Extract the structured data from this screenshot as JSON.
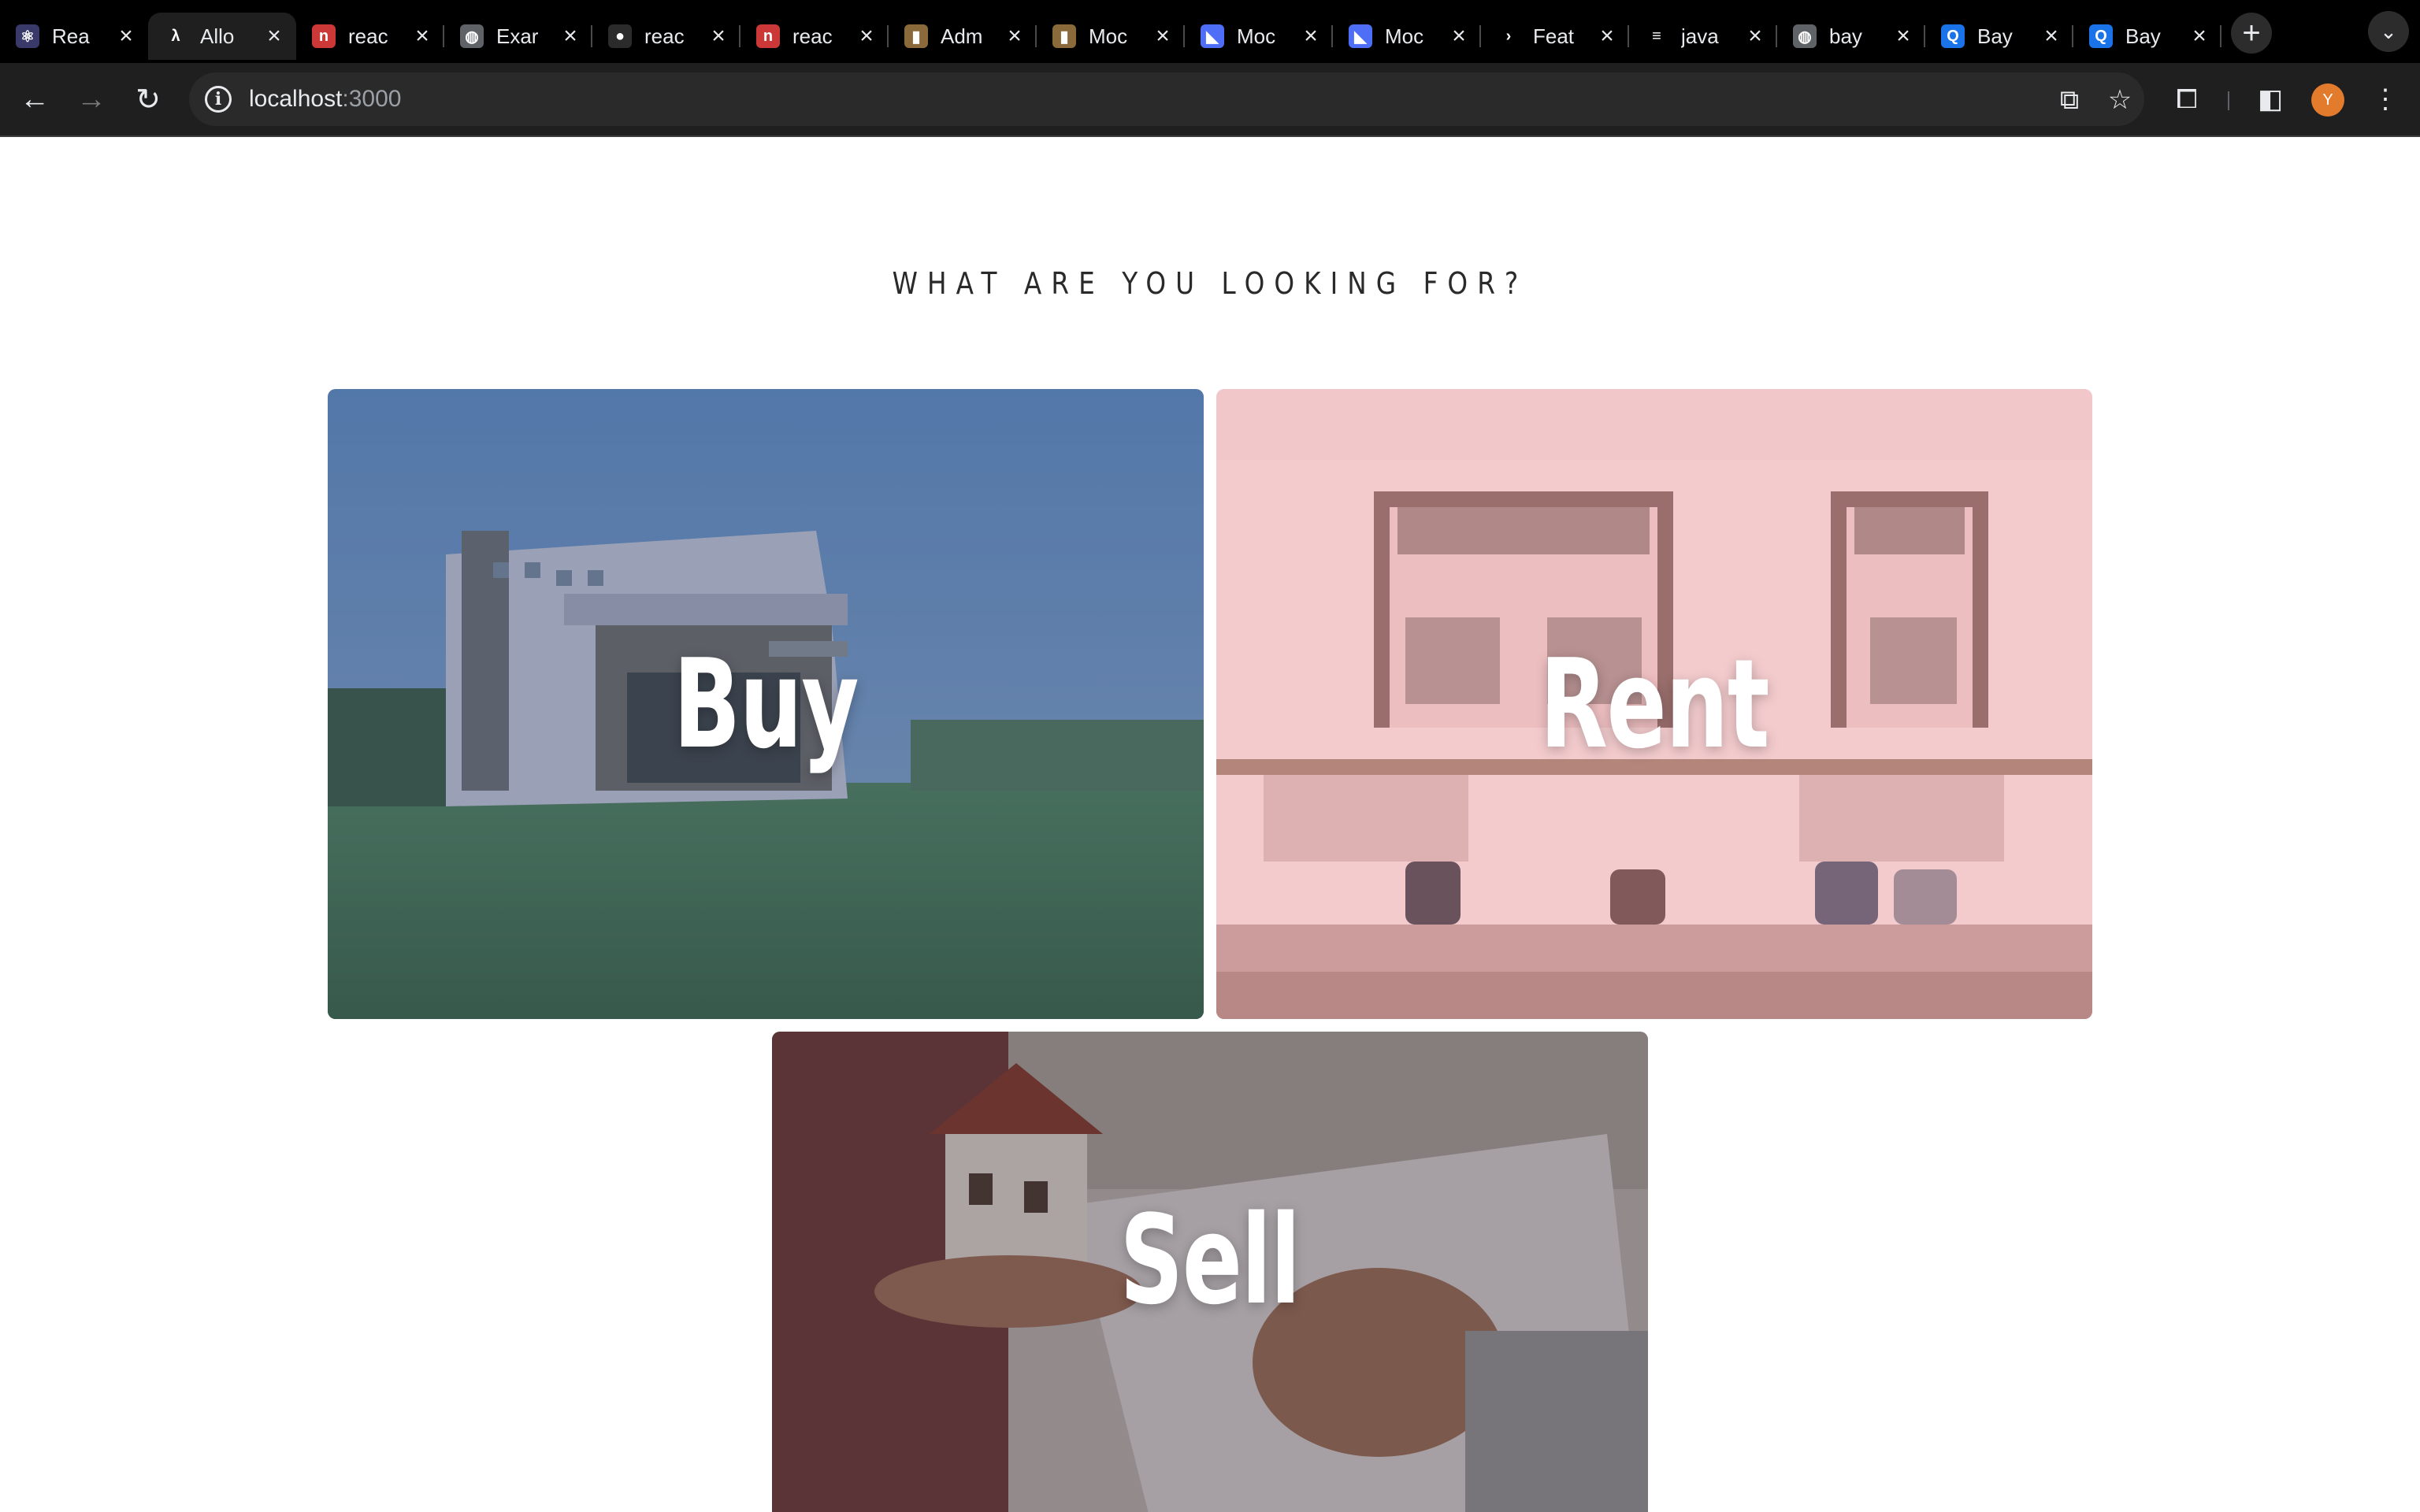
{
  "browser": {
    "tabs": [
      {
        "title": "Rea",
        "icon": "react-icon",
        "color": "#3a3a6a",
        "glyph": "⚛"
      },
      {
        "title": "Allo",
        "icon": "lambda-icon",
        "color": "#1f1f1f",
        "glyph": "λ",
        "active": true
      },
      {
        "title": "reac",
        "icon": "npm-icon",
        "color": "#cb3837",
        "glyph": "n"
      },
      {
        "title": "Exar",
        "icon": "globe-icon",
        "color": "#5f6368",
        "glyph": "◍"
      },
      {
        "title": "reac",
        "icon": "github-icon",
        "color": "#2b2b2b",
        "glyph": "●"
      },
      {
        "title": "reac",
        "icon": "npm-icon",
        "color": "#cb3837",
        "glyph": "n"
      },
      {
        "title": "Adm",
        "icon": "book-icon",
        "color": "#8a6a3a",
        "glyph": "▮"
      },
      {
        "title": "Moc",
        "icon": "book-icon",
        "color": "#8a6a3a",
        "glyph": "▮"
      },
      {
        "title": "Moc",
        "icon": "mui-icon",
        "color": "#4f6ef7",
        "glyph": "◣"
      },
      {
        "title": "Moc",
        "icon": "mui-icon",
        "color": "#4f6ef7",
        "glyph": "◣"
      },
      {
        "title": "Feat",
        "icon": "chevron-right-icon",
        "color": "#000000",
        "glyph": "›"
      },
      {
        "title": "java",
        "icon": "stackoverflow-icon",
        "color": "#000000",
        "glyph": "≡"
      },
      {
        "title": "bay",
        "icon": "globe-icon",
        "color": "#5f6368",
        "glyph": "◍"
      },
      {
        "title": "Bay",
        "icon": "search-icon",
        "color": "#1a73e8",
        "glyph": "Q"
      },
      {
        "title": "Bay",
        "icon": "search-icon",
        "color": "#1a73e8",
        "glyph": "Q"
      }
    ],
    "url_host": "localhost",
    "url_port": ":3000",
    "avatar_initial": "Y"
  },
  "page": {
    "heading": "WHAT ARE YOU LOOKING FOR?",
    "cards": {
      "buy": "Buy",
      "rent": "Rent",
      "sell": "Sell"
    }
  },
  "colors": {
    "buy_overlay": "#3a5a8a",
    "rent_overlay": "#e8a0a8",
    "sell_overlay": "#3a2a30"
  }
}
